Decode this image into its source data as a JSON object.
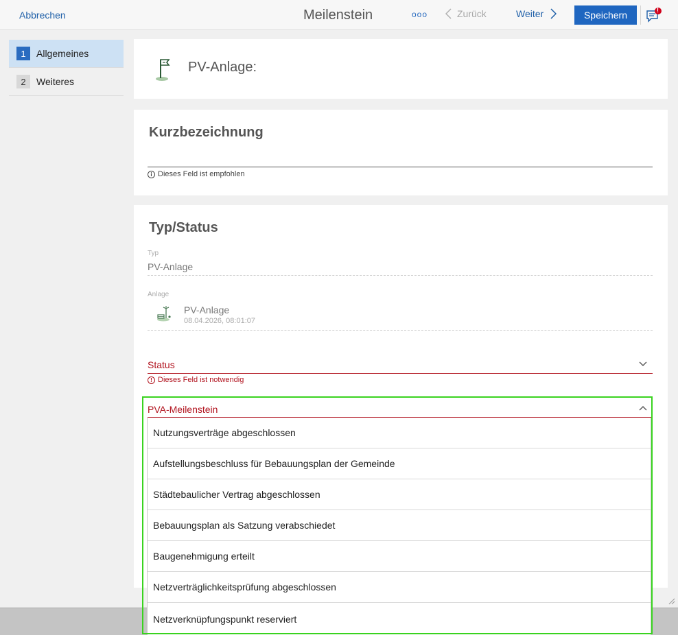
{
  "header": {
    "cancel_label": "Abbrechen",
    "title": "Meilenstein",
    "more_label": "ooo",
    "back_label": "Zurück",
    "next_label": "Weiter",
    "save_label": "Speichern",
    "notification_badge": "!"
  },
  "sidebar": {
    "items": [
      {
        "number": "1",
        "label": "Allgemeines",
        "active": true
      },
      {
        "number": "2",
        "label": "Weiteres",
        "active": false
      }
    ]
  },
  "record": {
    "title": "PV-Anlage:",
    "icon": "flag-icon"
  },
  "short_section": {
    "title": "Kurzbezeichnung",
    "value": "",
    "hint": "Dieses Feld ist empfohlen"
  },
  "type_section": {
    "title": "Typ/Status",
    "type_label": "Typ",
    "type_value": "PV-Anlage",
    "plant_label": "Anlage",
    "plant_name": "PV-Anlage",
    "plant_date": "08.04.2026, 08:01:07",
    "status_label": "Status",
    "status_hint": "Dieses Feld ist notwendig",
    "milestone_label": "PVA-Meilenstein"
  },
  "milestone_options": [
    "Nutzungsverträge abgeschlossen",
    "Aufstellungsbeschluss für Bebauungsplan der Gemeinde",
    "Städtebaulicher Vertrag abgeschlossen",
    "Bebauungsplan als Satzung verabschiedet",
    "Baugenehmigung erteilt",
    "Netzverträglichkeitsprüfung abgeschlossen",
    "Netzverknüpfungspunkt reserviert"
  ],
  "colors": {
    "accent": "#1f66c0",
    "error": "#b1121d",
    "focus": "#39d31f",
    "active_nav": "#cde1f4"
  }
}
